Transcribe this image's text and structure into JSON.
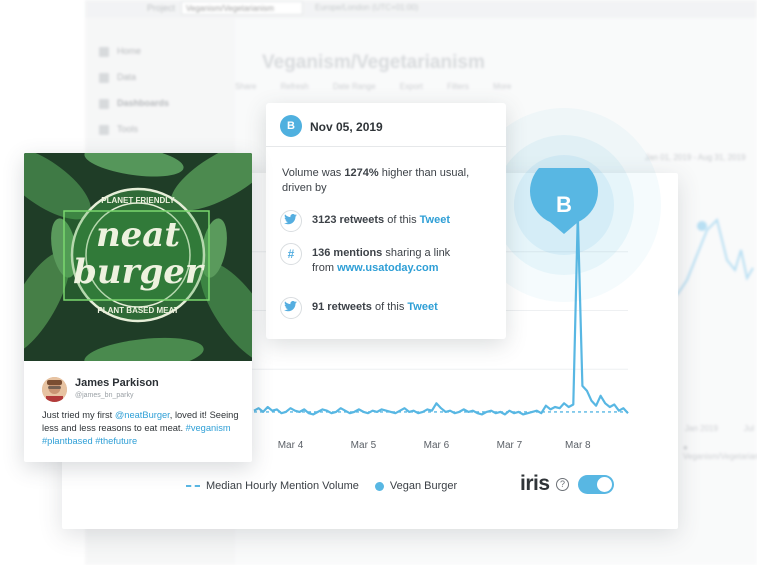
{
  "background_app": {
    "project_label": "Project",
    "project_value": "Veganism/Vegetarianism",
    "timezone": "Europe/London (UTC+01:00)",
    "nav": [
      "Home",
      "Data",
      "Dashboards",
      "Tools"
    ],
    "page_title": "Veganism/Vegetarianism",
    "toolbar": [
      "Share",
      "Refresh",
      "Date Range",
      "Export",
      "Filters",
      "More"
    ],
    "date_range": "Jan 01, 2019 - Aug 31, 2019",
    "right_xticks": [
      "Jan 2019",
      "Jul"
    ],
    "right_legend": "Veganism/Vegetarianism"
  },
  "chart_data": {
    "type": "line",
    "x_ticks": [
      "Mar 4",
      "Mar 5",
      "Mar 6",
      "Mar 7",
      "Mar 8"
    ],
    "series": [
      {
        "name": "Vegan Burger",
        "values": [
          14,
          16,
          13,
          17,
          14,
          15,
          12,
          13,
          16,
          14,
          13,
          15,
          12,
          11,
          13,
          15,
          14,
          12,
          13,
          16,
          14,
          12,
          13,
          15,
          13,
          12,
          14,
          13,
          15,
          14,
          13,
          12,
          14,
          16,
          13,
          14,
          12,
          13,
          15,
          14,
          20,
          16,
          13,
          14,
          12,
          13,
          15,
          13,
          14,
          12,
          11,
          13,
          14,
          12,
          13,
          11,
          14,
          12,
          13,
          11,
          12,
          13,
          14,
          12,
          18,
          15,
          17,
          16,
          20,
          17,
          19,
          172,
          34,
          30,
          22,
          18,
          26,
          20,
          17,
          19,
          14,
          16,
          12
        ]
      },
      {
        "name": "Median Hourly Mention Volume",
        "value": 13
      }
    ],
    "legend": [
      "Median Hourly Mention Volume",
      "Vegan Burger"
    ],
    "colors": {
      "line": "#58b7e3",
      "median": "#58b7e3"
    },
    "ylim": [
      0,
      190
    ]
  },
  "marker": {
    "label": "B"
  },
  "iris": {
    "logo": "iris",
    "help": "?",
    "enabled": true
  },
  "tooltip": {
    "badge": "B",
    "date": "Nov 05, 2019",
    "summary_prefix": "Volume was ",
    "summary_value": "1274%",
    "summary_suffix": " higher than usual, driven by",
    "rows": [
      {
        "icon": "twitter-icon",
        "count": "3123 retweets",
        "middle": " of this ",
        "link": "Tweet"
      },
      {
        "icon": "hashtag-icon",
        "count": "136 mentions",
        "middle": " sharing a link from ",
        "link": "www.usatoday.com"
      },
      {
        "icon": "twitter-icon",
        "count": "91 retweets",
        "middle": " of this ",
        "link": "Tweet"
      }
    ]
  },
  "tweet": {
    "image_logo_line1": "neat",
    "image_logo_line2": "burger",
    "image_ring_top": "PLANET FRIENDLY",
    "image_ring_bottom": "PLANT BASED MEAT",
    "name": "James Parkison",
    "handle": "@james_bn_parky",
    "text_1": "Just tried my first ",
    "mention": "@neatBurger",
    "text_2": ", loved it! Seeing less and less reasons to eat meat. ",
    "hashtags": "#veganism #plantbased #thefuture"
  }
}
